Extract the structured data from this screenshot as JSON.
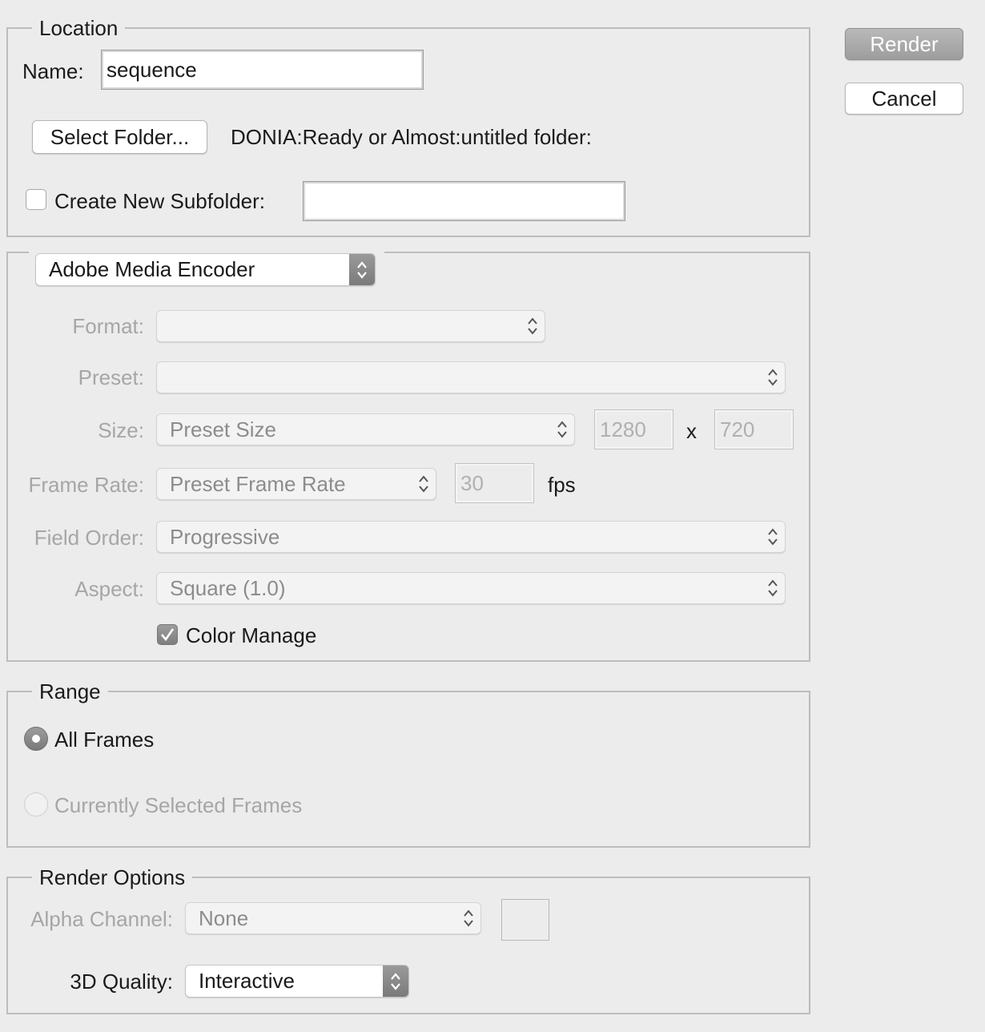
{
  "location": {
    "legend": "Location",
    "name_label": "Name:",
    "name_value": "sequence",
    "select_folder_label": "Select Folder...",
    "folder_path": "DONIA:Ready or Almost:untitled folder:",
    "subfolder_label": "Create New Subfolder:",
    "subfolder_checked": false,
    "subfolder_value": ""
  },
  "encoder": {
    "selected": "Adobe Media Encoder",
    "format_label": "Format:",
    "format_value": "",
    "preset_label": "Preset:",
    "preset_value": "",
    "size_label": "Size:",
    "size_value": "Preset Size",
    "width_placeholder": "1280",
    "x_label": "x",
    "height_placeholder": "720",
    "frame_rate_label": "Frame Rate:",
    "frame_rate_value": "Preset Frame Rate",
    "fps_placeholder": "30",
    "fps_label": "fps",
    "field_order_label": "Field Order:",
    "field_order_value": "Progressive",
    "aspect_label": "Aspect:",
    "aspect_value": "Square (1.0)",
    "color_manage_label": "Color Manage",
    "color_manage_checked": true
  },
  "range": {
    "legend": "Range",
    "all_frames_label": "All Frames",
    "selected_frames_label": "Currently Selected Frames"
  },
  "render_options": {
    "legend": "Render Options",
    "alpha_label": "Alpha Channel:",
    "alpha_value": "None",
    "quality_label": "3D Quality:",
    "quality_value": "Interactive"
  },
  "buttons": {
    "render_label": "Render",
    "cancel_label": "Cancel"
  },
  "icons": {
    "popup": "updown-chevron-icon",
    "check": "checkmark-icon"
  }
}
